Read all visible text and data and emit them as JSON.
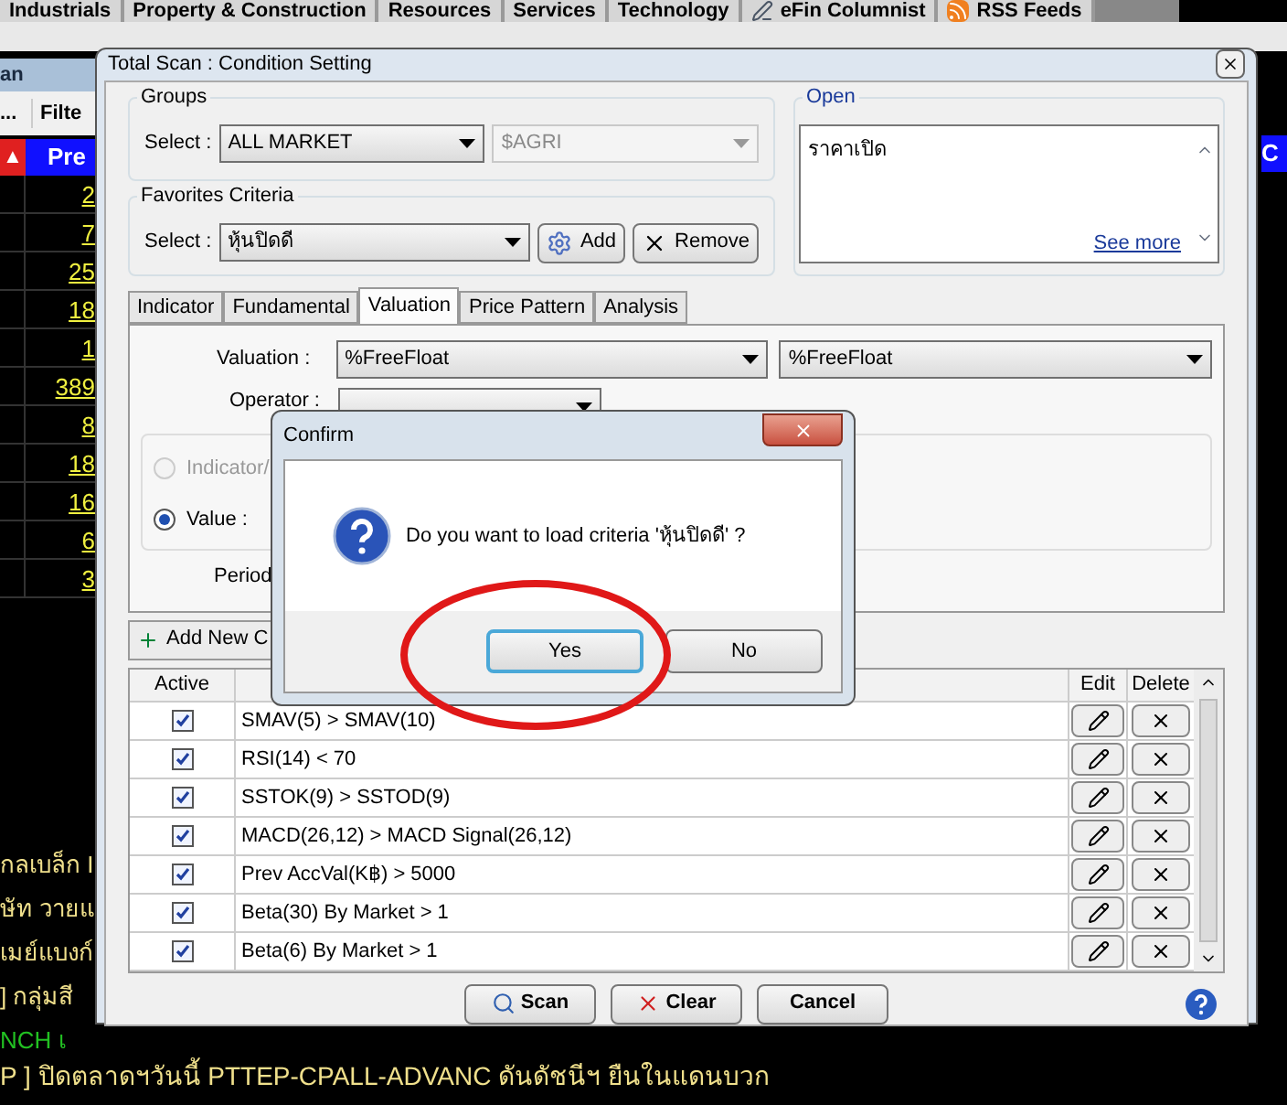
{
  "background_app": {
    "top_tabs": [
      {
        "label": "Industrials",
        "kind": "plain"
      },
      {
        "label": "Property & Construction",
        "kind": "plain"
      },
      {
        "label": "Resources",
        "kind": "plain"
      },
      {
        "label": "Services",
        "kind": "plain"
      },
      {
        "label": "Technology",
        "kind": "plain"
      },
      {
        "label": "eFin Columnist",
        "kind": "pen"
      },
      {
        "label": "RSS Feeds",
        "kind": "rss"
      }
    ],
    "panel_title": "an",
    "column_headers": [
      "...",
      "Filte"
    ],
    "sort_mark": "▲",
    "price_header": "Pre",
    "right_header": "C",
    "prices": [
      "2",
      "7",
      "25",
      "18",
      "1",
      "389",
      "8",
      "18",
      "16",
      "6",
      "3"
    ],
    "news": [
      {
        "text": "กลเบล็ก I",
        "color": "#f0e08c"
      },
      {
        "text": "ษัท วายแ",
        "color": "#f0e08c"
      },
      {
        "text": "เมย์แบงก์",
        "color": "#f0e08c"
      },
      {
        "text": "] กลุ่มสี",
        "color": "#f0e08c"
      },
      {
        "text": "NCH เ",
        "color": "#22c022"
      },
      {
        "text": "P ]  ปิดตลาดฯวันนี้ PTTEP-CPALL-ADVANC ดันดัชนีฯ ยืนในแดนบวก",
        "color": "#f0e08c"
      }
    ]
  },
  "main_dialog": {
    "title": "Total Scan : Condition Setting",
    "groups": {
      "label": "Groups",
      "select_label": "Select :",
      "market": "ALL MARKET",
      "sector": "$AGRI",
      "sector_disabled": true
    },
    "favorites": {
      "label": "Favorites Criteria",
      "select_label": "Select :",
      "value": "หุ้นปิดดี",
      "add": "Add",
      "remove": "Remove"
    },
    "open": {
      "label": "Open",
      "text": "ราคาเปิด",
      "link": "See more"
    },
    "tabs": [
      {
        "label": "Indicator",
        "selected": false
      },
      {
        "label": "Fundamental",
        "selected": false
      },
      {
        "label": "Valuation",
        "selected": true
      },
      {
        "label": "Price Pattern",
        "selected": false
      },
      {
        "label": "Analysis",
        "selected": false
      }
    ],
    "valuation": {
      "label": "Valuation :",
      "field_1": "%FreeFloat",
      "field_2": "%FreeFloat",
      "operator_label": "Operator :",
      "options": [
        {
          "label": "Indicator/",
          "selected": false,
          "disabled": true
        },
        {
          "label": "Value :",
          "selected": true,
          "disabled": false
        }
      ],
      "period_label": "Period"
    },
    "add_condition": "Add New C",
    "table": {
      "columns": [
        "Active",
        "Edit",
        "Delete"
      ],
      "rows": [
        {
          "condition": "SMAV(5) > SMAV(10)",
          "active": true
        },
        {
          "condition": "RSI(14) < 70",
          "active": true
        },
        {
          "condition": "SSTOK(9) > SSTOD(9)",
          "active": true
        },
        {
          "condition": "MACD(26,12) > MACD Signal(26,12)",
          "active": true
        },
        {
          "condition": "Prev AccVal(K฿) > 5000",
          "active": true
        },
        {
          "condition": "Beta(30) By Market > 1",
          "active": true
        },
        {
          "condition": "Beta(6) By Market > 1",
          "active": true
        }
      ]
    },
    "buttons": [
      {
        "label": "Scan",
        "kind": "scan"
      },
      {
        "label": "Clear",
        "kind": "clear"
      },
      {
        "label": "Cancel",
        "kind": "cancel"
      }
    ]
  },
  "confirm": {
    "title": "Confirm",
    "message": "Do you want to load criteria 'หุ้นปิดดี' ?",
    "buttons": [
      {
        "label": "Yes",
        "default": true
      },
      {
        "label": "No",
        "default": false
      }
    ],
    "highlighted": true
  }
}
